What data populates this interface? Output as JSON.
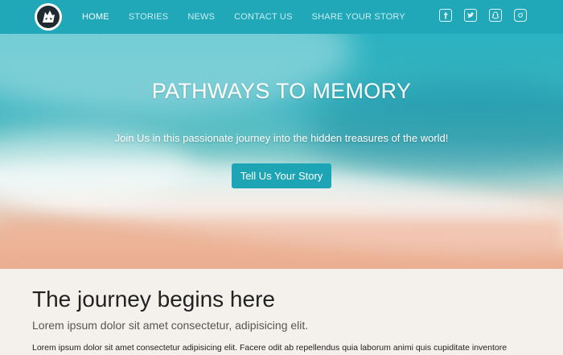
{
  "nav": {
    "logo_icon": "wolf-logo-icon",
    "links": [
      {
        "label": "HOME",
        "active": true
      },
      {
        "label": "STORIES",
        "active": false
      },
      {
        "label": "NEWS",
        "active": false
      },
      {
        "label": "CONTACT US",
        "active": false
      },
      {
        "label": "SHARE YOUR STORY",
        "active": false
      }
    ],
    "socials": [
      "facebook-icon",
      "twitter-icon",
      "snapchat-icon",
      "instagram-icon"
    ]
  },
  "hero": {
    "title": "PATHWAYS TO MEMORY",
    "subtitle": "Join Us in this passionate journey into the hidden treasures of the world!",
    "cta_label": "Tell Us Your Story"
  },
  "content": {
    "title": "The journey begins here",
    "lead": "Lorem ipsum dolor sit amet consectetur, adipisicing elit.",
    "body": "Lorem ipsum dolor sit amet consectetur adipisicing elit. Facere odit ab repellendus quia laborum animi quis cupiditate inventore"
  },
  "colors": {
    "accent": "#20a7b8",
    "background": "#f4f0ec"
  }
}
